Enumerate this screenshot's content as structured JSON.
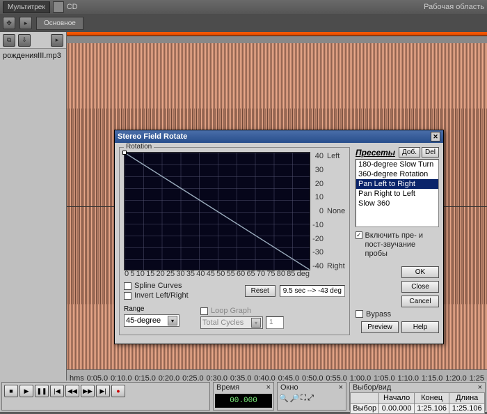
{
  "top": {
    "multitrack": "Мультитрек",
    "cd": "CD",
    "workspace": "Рабочая область"
  },
  "panel_tab": "Основное",
  "file_panel": {
    "file_name": "рожденияIII.mp3"
  },
  "timeline": {
    "ticks": [
      "hms",
      "0:05.0",
      "0:10.0",
      "0:15.0",
      "0:20.0",
      "0:25.0",
      "0:30.0",
      "0:35.0",
      "0:40.0",
      "0:45.0",
      "0:50.0",
      "0:55.0",
      "1:00.0",
      "1:05.0",
      "1:10.0",
      "1:15.0",
      "1:20.0",
      "1:25"
    ]
  },
  "dialog": {
    "title": "Stereo Field Rotate",
    "rotation_label": "Rotation",
    "left_label": "Left",
    "none_label": "None",
    "right_label": "Right",
    "xaxis_unit": "deg",
    "x_ticks": [
      "0",
      "5",
      "10",
      "15",
      "20",
      "25",
      "30",
      "35",
      "40",
      "45",
      "50",
      "55",
      "60",
      "65",
      "70",
      "75",
      "80",
      "85"
    ],
    "db_ticks": [
      "40",
      "30",
      "20",
      "10",
      "0",
      "-10",
      "-20",
      "-30",
      "-40"
    ],
    "spline_curves": "Spline Curves",
    "invert_lr": "Invert Left/Right",
    "range_label": "Range",
    "range_value": "45-degree",
    "loop_graph": "Loop Graph",
    "loop_cycle_label": "Total Cycles",
    "loop_cycle_value": "1",
    "reset_btn": "Reset",
    "status_text": "9.5 sec --> -43 deg",
    "presets": {
      "title": "Пресеты",
      "add": "Доб.",
      "del": "Del",
      "items": [
        "180-degree Slow Turn",
        "360-degree Rotation",
        "Pan Left to Right",
        "Pan Right to Left",
        "Slow 360"
      ],
      "selected_index": 2
    },
    "include_prepost": "Включить пре- и пост-звучание пробы",
    "ok": "OK",
    "close": "Close",
    "cancel": "Cancel",
    "bypass": "Bypass",
    "preview": "Preview",
    "help": "Help"
  },
  "bottom": {
    "time_panel": "Время",
    "window_panel": "Окно",
    "selview_panel": "Выбор/вид",
    "timecode": "00.000",
    "table": {
      "headers": [
        "Начало",
        "Конец",
        "Длина"
      ],
      "rows": [
        {
          "label": "Выбор",
          "start": "0.00.000",
          "end": "1:25.106",
          "len": "1:25.106"
        }
      ]
    }
  },
  "chart_data": {
    "type": "line",
    "title": "Rotation",
    "xlabel": "deg",
    "ylabel": "",
    "x": [
      0,
      85
    ],
    "y": [
      45,
      -45
    ],
    "x_ticks": [
      0,
      5,
      10,
      15,
      20,
      25,
      30,
      35,
      40,
      45,
      50,
      55,
      60,
      65,
      70,
      75,
      80,
      85
    ],
    "y_ticks": [
      40,
      30,
      20,
      10,
      0,
      -10,
      -20,
      -30,
      -40
    ],
    "ylim": [
      -45,
      45
    ],
    "xlim": [
      0,
      85
    ],
    "right_axis_labels": [
      "Left",
      "None",
      "Right"
    ]
  }
}
